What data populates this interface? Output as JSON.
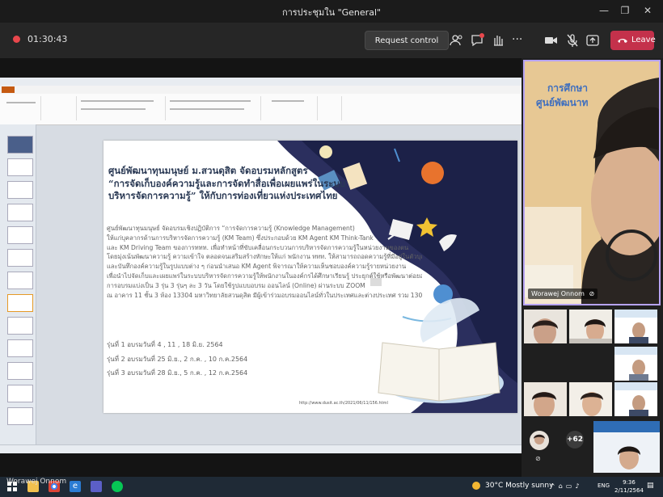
{
  "window": {
    "title": "การประชุมใน \"General\""
  },
  "meeting": {
    "elapsed": "01:30:43",
    "request_control_label": "Request control",
    "leave_label": "Leave",
    "colors": {
      "leave": "#c4314b",
      "recording": "#e8474c",
      "active_speaker_border": "#b6a3f2"
    }
  },
  "slide": {
    "title_lines": [
      "ศูนย์พัฒนาทุนมนุษย์ ม.สวนดุสิต จัดอบรมหลักสูตร",
      "“การจัดเก็บองค์ความรู้และการจัดทำสื่อเพื่อเผยแพร่ในระบบ",
      "บริหารจัดการความรู้” ให้กับการท่องเที่ยวแห่งประเทศไทย"
    ],
    "body_lines": [
      "ศูนย์พัฒนาทุนมนุษย์ จัดอบรมเชิงปฏิบัติการ “การจัดการความรู้ (Knowledge Management)",
      "ให้แก่บุคลากรด้านการบริหารจัดการความรู้ (KM Team) ซึ่งประกอบด้วย KM Agent  KM Think-Tank",
      "และ KM Driving Team ของการททท. เพื่อทำหน้าที่ขับเคลื่อนกระบวนการบริหารจัดการความรู้ในหน่วยงานของตน",
      "โดยมุ่งเน้นพัฒนาความรู้ ความเข้าใจ ตลอดจนเสริมสร้างทักษะให้แก่ พนักงาน ททท. ให้สามารถถอดความรู้ที่มีอยู่ในตัวบุคคล",
      "และบันทึกองค์ความรู้ในรูปแบบต่าง ๆ ก่อนนำเสนอ KM Agent พิจารณาให้ความเห็นชอบองค์ความรู้รายหน่วยงาน",
      "เพื่อนำไปจัดเก็บและเผยแพร่ในระบบบริหารจัดการความรู้ให้พนักงานในองค์กรได้ศึกษาเรียนรู้  ประยุกต์ใช้หรือพัฒนาต่อยอดความรู้ต่อไป",
      "การอบรมแบ่งเป็น 3 รุ่น 3 รุ่นๆ ละ 3 วัน โดยใช้รูปแบบอบรม ออนไลน์ (Online) ผ่านระบบ ZOOM",
      "ณ อาคาร 11 ชั้น 3  ห้อง  13304 มหาวิทยาลัยสวนดุสิต มีผู้เข้าร่วมอบรมออนไลน์ทั่วในประเทศและต่างประเทศ รวม 130 คน"
    ],
    "rounds": [
      "รุ่นที่ 1 อบรมวันที่ 4 , 11 , 18 มิ.ย. 2564",
      "รุ่นที่ 2 อบรมวันที่ 25 มิ.ย., 2 ก.ค. , 10 ก.ค.2564",
      "รุ่นที่ 3 อบรมวันที่ 28 มิ.ย., 5 ก.ค. , 12 ก.ค.2564"
    ],
    "url": "http://www.dusit.ac.th/2021/06/11/156.html"
  },
  "participants": {
    "active_speaker_name": "Worawej Onnom",
    "active_speaker_backdrop": [
      "การศึกษา",
      "ศูนย์พัฒนาท"
    ],
    "overflow_count": "+62",
    "presenter_name": "Worawej Onnom"
  },
  "taskbar": {
    "weather": "30°C  Mostly sunny",
    "language": "ENG",
    "time": "9:36",
    "date": "2/11/2564"
  }
}
